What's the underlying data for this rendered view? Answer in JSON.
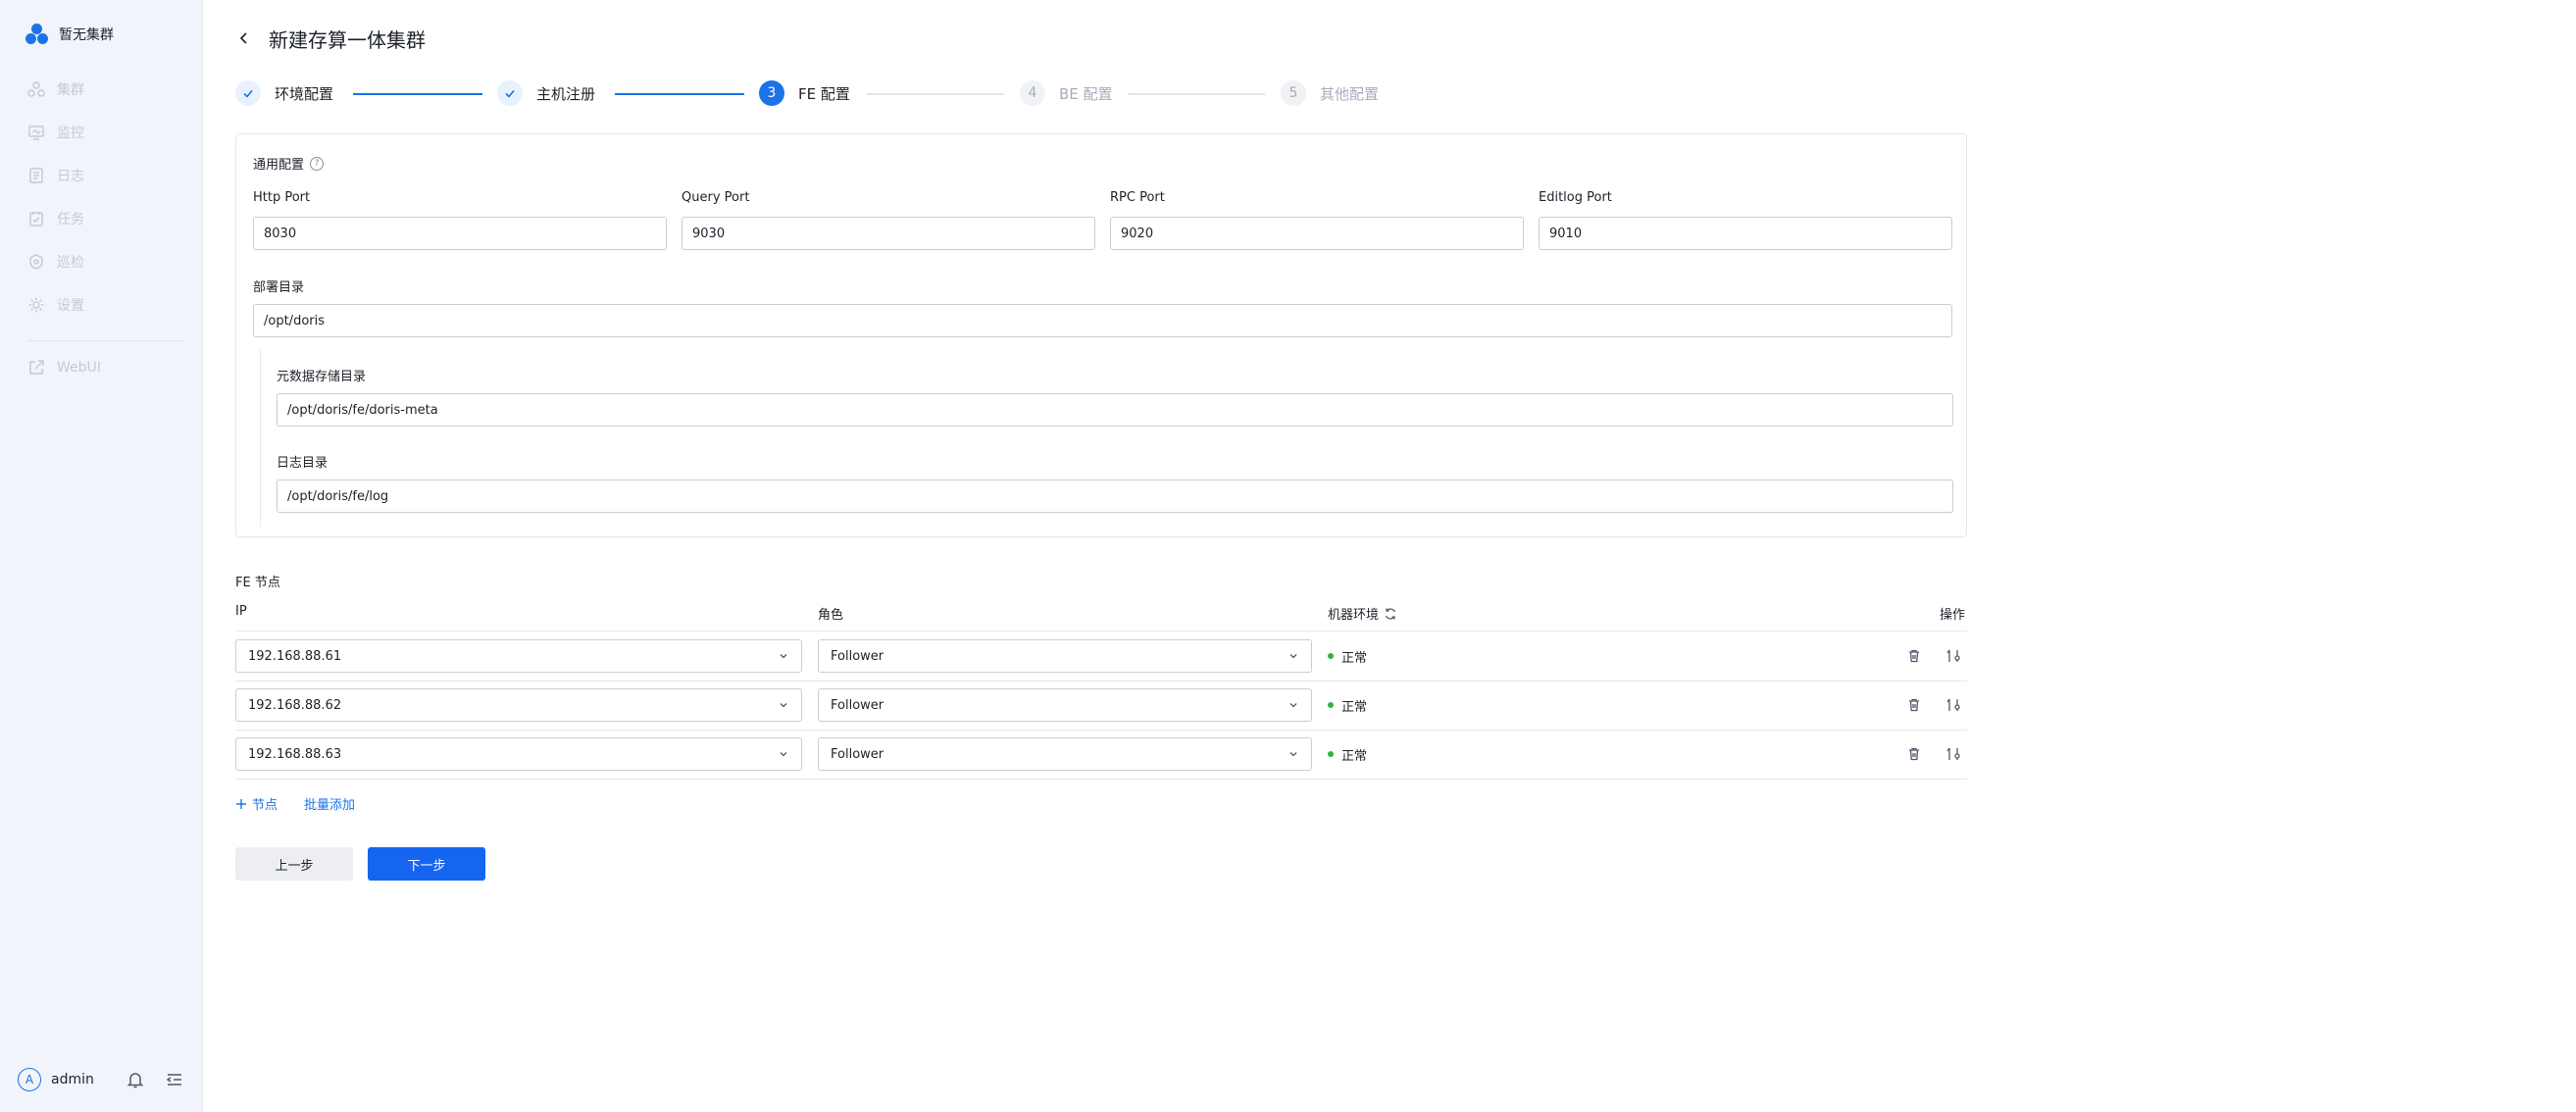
{
  "sidebar": {
    "brand": "暂无集群",
    "items": [
      {
        "label": "集群",
        "icon": "cluster-icon"
      },
      {
        "label": "监控",
        "icon": "monitor-icon"
      },
      {
        "label": "日志",
        "icon": "log-icon"
      },
      {
        "label": "任务",
        "icon": "task-icon"
      },
      {
        "label": "巡检",
        "icon": "inspection-icon"
      },
      {
        "label": "设置",
        "icon": "settings-icon"
      },
      {
        "label": "WebUI",
        "icon": "external-link-icon"
      }
    ],
    "user": {
      "avatar": "A",
      "name": "admin"
    }
  },
  "header": {
    "title": "新建存算一体集群"
  },
  "steps": [
    {
      "number": "1",
      "label": "环境配置",
      "state": "done"
    },
    {
      "number": "2",
      "label": "主机注册",
      "state": "done"
    },
    {
      "number": "3",
      "label": "FE 配置",
      "state": "active"
    },
    {
      "number": "4",
      "label": "BE 配置",
      "state": "todo"
    },
    {
      "number": "5",
      "label": "其他配置",
      "state": "todo"
    }
  ],
  "general_config": {
    "title": "通用配置",
    "http_port": {
      "label": "Http Port",
      "value": "8030"
    },
    "query_port": {
      "label": "Query Port",
      "value": "9030"
    },
    "rpc_port": {
      "label": "RPC Port",
      "value": "9020"
    },
    "editlog_port": {
      "label": "Editlog Port",
      "value": "9010"
    },
    "deploy_dir": {
      "label": "部署目录",
      "value": "/opt/doris"
    },
    "meta_dir": {
      "label": "元数据存储目录",
      "value": "/opt/doris/fe/doris-meta"
    },
    "log_dir": {
      "label": "日志目录",
      "value": "/opt/doris/fe/log"
    }
  },
  "fe_nodes": {
    "title": "FE 节点",
    "columns": {
      "ip": "IP",
      "role": "角色",
      "env": "机器环境",
      "ops": "操作"
    },
    "rows": [
      {
        "ip": "192.168.88.61",
        "role": "Follower",
        "status": "正常"
      },
      {
        "ip": "192.168.88.62",
        "role": "Follower",
        "status": "正常"
      },
      {
        "ip": "192.168.88.63",
        "role": "Follower",
        "status": "正常"
      }
    ],
    "add_node": "节点",
    "batch_add": "批量添加"
  },
  "actions": {
    "prev": "上一步",
    "next": "下一步"
  },
  "colors": {
    "primary": "#1565f0",
    "accent": "#1a73e8",
    "success": "#2fb344",
    "sidebar_bg": "#f1f4fa"
  }
}
